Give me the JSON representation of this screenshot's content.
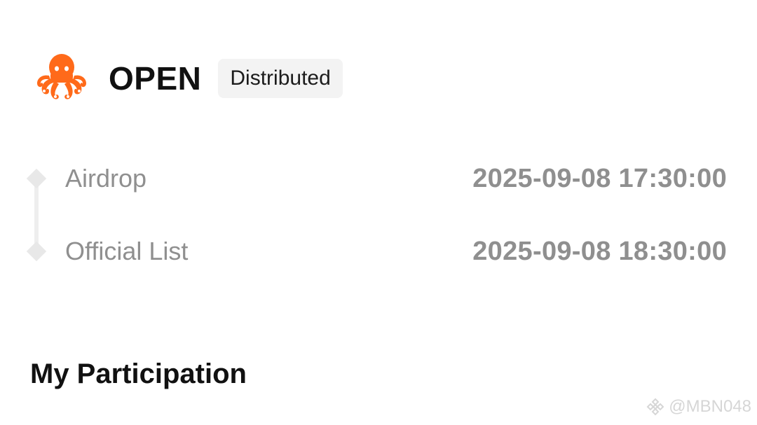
{
  "token": {
    "name": "OPEN",
    "status": "Distributed",
    "logo_icon": "octopus-icon",
    "logo_color": "#FF6A1A"
  },
  "timeline": {
    "items": [
      {
        "label": "Airdrop",
        "time": "2025-09-08 17:30:00"
      },
      {
        "label": "Official List",
        "time": "2025-09-08 18:30:00"
      }
    ]
  },
  "section": {
    "title": "My Participation"
  },
  "watermark": {
    "text": "@MBN048",
    "icon": "binance-icon"
  }
}
